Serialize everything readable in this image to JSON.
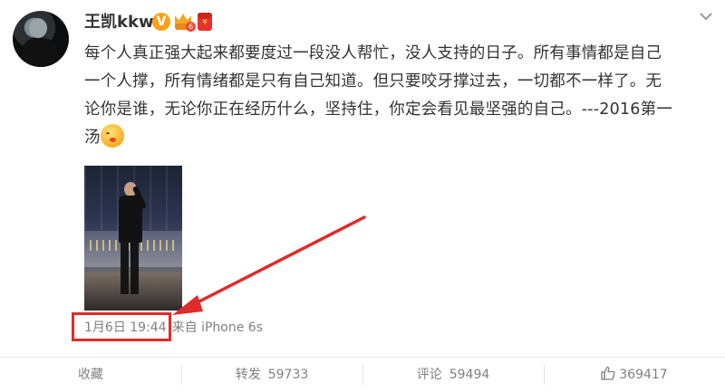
{
  "user": {
    "name": "王凯kkw",
    "verified_mark": "V",
    "level": "6",
    "redpacket_mark": "¥"
  },
  "post": {
    "text": "每个人真正强大起来都要度过一段没人帮忙，没人支持的日子。所有事情都是自己\n一个人撑，所有情绪都是只有自己知道。但只要咬牙撑过去，一切都不一样了。无\n论你是谁，无论你正在经历什么，坚持住，你定会看见最坚强的自己。---2016第一\n汤",
    "emoji": "grin-emoji"
  },
  "meta": {
    "time": "1月6日 19:44",
    "source": "来自 iPhone 6s"
  },
  "actions": {
    "favorite": "收藏",
    "repost": "转发",
    "repost_count": "59733",
    "comment": "评论",
    "comment_count": "59494",
    "like_count": "369417"
  },
  "colors": {
    "highlight": "#e02b2b",
    "verified": "#f7a21b",
    "text": "#333333",
    "muted": "#808080"
  },
  "icons": [
    "menu-chevron-icon",
    "thumbs-up-icon",
    "crown-icon",
    "hongbao-icon"
  ]
}
